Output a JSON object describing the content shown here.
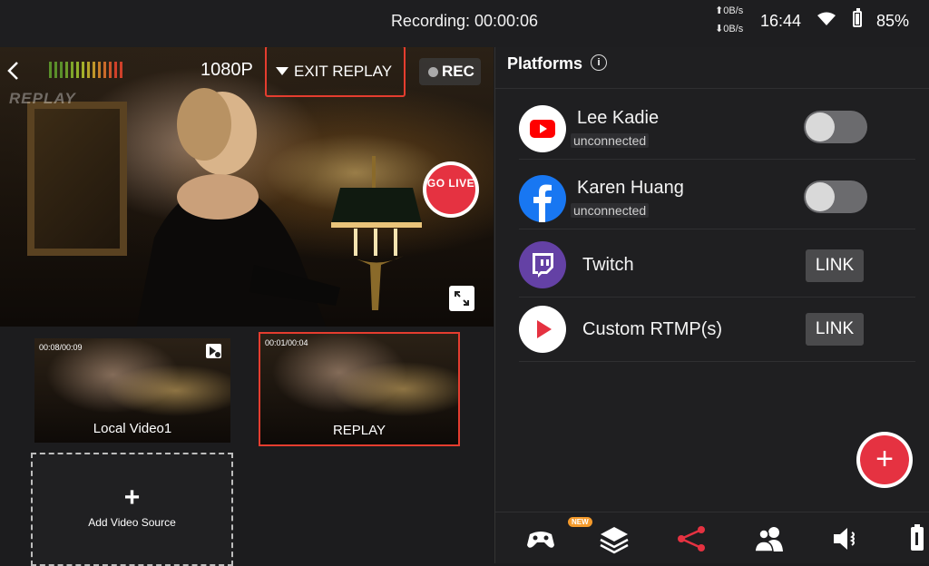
{
  "status_bar": {
    "recording": "Recording: 00:00:06",
    "upload_speed": "⬆0B/s",
    "download_speed": "⬇0B/s",
    "time": "16:44",
    "battery": "85%",
    "battery_level": 0.85
  },
  "preview": {
    "watermark": "REPLAY",
    "resolution": "1080P",
    "exit_replay": "EXIT REPLAY",
    "rec": "REC",
    "go_live": "GO LIVE",
    "audio_meter_colors": [
      "#5a8f2a",
      "#5a8f2a",
      "#5a8f2a",
      "#6b9a2a",
      "#7ea52a",
      "#8faf2a",
      "#a3b02a",
      "#b4a52a",
      "#c0962a",
      "#c67f2a",
      "#c96a2a",
      "#cc542a",
      "#cf402a",
      "#cf402a"
    ]
  },
  "sources": {
    "local": {
      "time": "00:08/00:09",
      "label": "Local Video1"
    },
    "replay": {
      "time": "00:01/00:04",
      "label": "REPLAY"
    },
    "add": {
      "plus": "+",
      "label": "Add Video Source"
    }
  },
  "platforms": {
    "title": "Platforms",
    "info": "i",
    "items": [
      {
        "name": "Lee Kadie",
        "status": "unconnected",
        "icon": "youtube-icon",
        "color": "#ff0000"
      },
      {
        "name": "Karen Huang",
        "status": "unconnected",
        "icon": "facebook-icon",
        "color": "#1877f2"
      },
      {
        "name": "Twitch",
        "action": "LINK",
        "icon": "twitch-icon",
        "color": "#6441a5"
      },
      {
        "name": "Custom RTMP(s)",
        "action": "LINK",
        "icon": "rtmp-play-icon",
        "color": "#e53241"
      }
    ],
    "add": "+"
  },
  "bottom_nav": {
    "new_badge": "NEW",
    "items": [
      "gamepad-icon",
      "layers-icon",
      "share-icon",
      "users-icon",
      "speaker-icon",
      "battery-tab-icon"
    ],
    "active_color": "#e53241"
  }
}
